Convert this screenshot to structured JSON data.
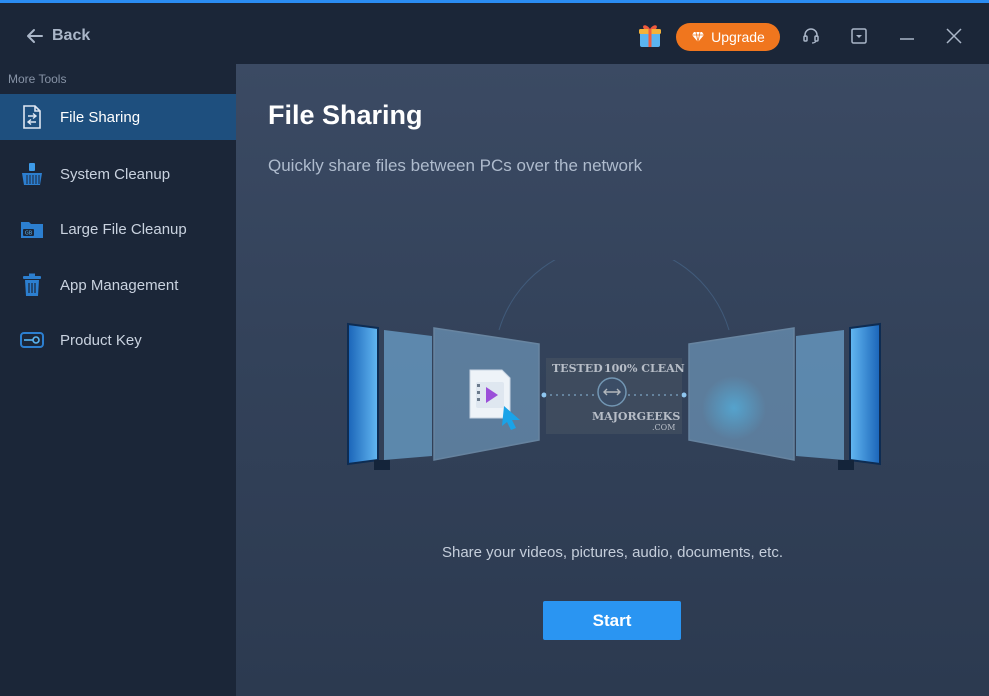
{
  "header": {
    "back_label": "Back",
    "upgrade_label": "Upgrade"
  },
  "sidebar": {
    "header": "More Tools",
    "items": [
      {
        "label": "File Sharing",
        "icon": "file-sharing-icon",
        "active": true
      },
      {
        "label": "System Cleanup",
        "icon": "broom-icon",
        "active": false
      },
      {
        "label": "Large File Cleanup",
        "icon": "folder-gb-icon",
        "active": false
      },
      {
        "label": "App Management",
        "icon": "trash-icon",
        "active": false
      },
      {
        "label": "Product Key",
        "icon": "key-icon",
        "active": false
      }
    ]
  },
  "main": {
    "title": "File Sharing",
    "subtitle": "Quickly share files between PCs over the network",
    "caption": "Share your videos, pictures, audio, documents, etc.",
    "start_label": "Start"
  },
  "watermark": {
    "line1": "TESTED",
    "line2": "100% CLEAN",
    "line3": "MAJORGEEKS",
    "line4": ".COM"
  },
  "colors": {
    "accent": "#2a95f2",
    "upgrade": "#f0761e",
    "sidebar_active": "#1e4f7e",
    "sidebar_bg": "#1b2638"
  }
}
